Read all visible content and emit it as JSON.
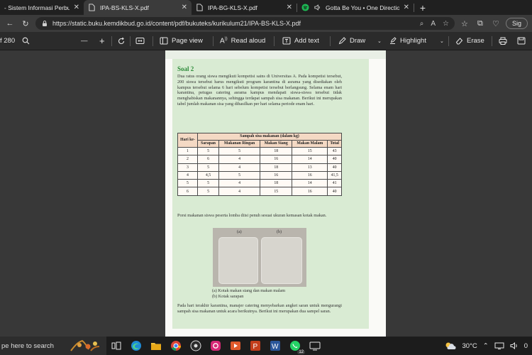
{
  "browser": {
    "tabs": [
      {
        "label": "- Sistem Informasi Perbukua",
        "active": false
      },
      {
        "label": "IPA-BS-KLS-X.pdf",
        "active": true
      },
      {
        "label": "IPA-BG-KLS-X.pdf",
        "active": false
      },
      {
        "label": "Gotta Be You • One Directio",
        "active": false
      }
    ],
    "tab_close": "✕",
    "new_tab": "+",
    "url": "https://static.buku.kemdikbud.go.id/content/pdf/bukuteks/kurikulum21/IPA-BS-KLS-X.pdf",
    "profile_label": "Sig"
  },
  "pdf_toolbar": {
    "page_count": "f 280",
    "minus": "—",
    "plus": "+",
    "page_view": "Page view",
    "read_aloud": "Read aloud",
    "add_text": "Add text",
    "draw": "Draw",
    "highlight": "Highlight",
    "erase": "Erase"
  },
  "document": {
    "soal_title": "Soal 2",
    "paragraph1": "Dua ratus orang siswa mengikuti kompetisi sains di Universitas A. Pada kompetisi tersebut, 200 siswa tersebut harus mengikuti program karantina di asrama yang disediakan oleh kampus tersebut selama 6 hari sebelum kompetisi tersebut berlangsung. Selama enam hari karantina, petugas catering asrama kampus mendapati siswa-siswa tersebut tidak menghabiskan makanannya, sehingga terdapat sampah sisa makanan. Berikut ini merupakan tabel jumlah makanan sisa yang dihasilkan per hari selama periode enam hari.",
    "table": {
      "header_day": "Hari ke-",
      "header_group": "Sampah sisa makanan (dalam kg)",
      "columns": [
        "Sarapan",
        "Makanan Ringan",
        "Makan Siang",
        "Makan Malam",
        "Total"
      ],
      "rows": [
        [
          "1",
          "5",
          "5",
          "18",
          "15",
          "43"
        ],
        [
          "2",
          "6",
          "4",
          "16",
          "14",
          "40"
        ],
        [
          "3",
          "5",
          "4",
          "18",
          "13",
          "40"
        ],
        [
          "4",
          "4,5",
          "5",
          "16",
          "16",
          "41,5"
        ],
        [
          "5",
          "5",
          "4",
          "18",
          "14",
          "41"
        ],
        [
          "6",
          "5",
          "4",
          "15",
          "16",
          "40"
        ]
      ]
    },
    "paragraph2": "Porsi makanan siswa peserta lomba diisi penuh sesuai ukuran kemasan kotak makan.",
    "photo_label_a": "(a)",
    "photo_label_b": "(b)",
    "caption_a": "(a) Kotak makan siang dan makan malam",
    "caption_b": "(b) Kotak sarapan",
    "paragraph3": "Pada hari terakhir karantina, manajer catering menyebarkan angket saran untuk mengurangi sampah sisa makanan untuk acara berikutnya. Berikut ini merupakan dua sampel saran."
  },
  "taskbar": {
    "search_placeholder": "pe here to search",
    "whatsapp_badge": "12",
    "temperature": "30°C",
    "clock": "0"
  }
}
